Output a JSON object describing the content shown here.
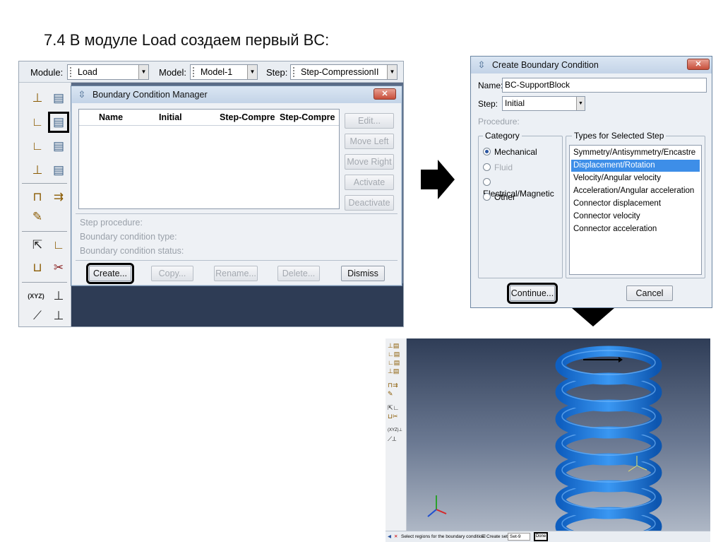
{
  "slide": {
    "title": "7.4 В модуле Load создаем первый BC:"
  },
  "context_bar": {
    "module_label": "Module:",
    "module_value": "Load",
    "model_label": "Model:",
    "model_value": "Model-1",
    "step_label": "Step:",
    "step_value": "Step-CompressionII"
  },
  "bc_manager": {
    "title": "Boundary Condition Manager",
    "close_label": "✕",
    "columns": [
      "Name",
      "Initial",
      "Step-Compre",
      "Step-Compre"
    ],
    "side_buttons": [
      "Edit...",
      "Move Left",
      "Move Right",
      "Activate",
      "Deactivate"
    ],
    "info": {
      "step_procedure": "Step procedure:",
      "bc_type": "Boundary condition type:",
      "bc_status": "Boundary condition status:"
    },
    "bottom_buttons": {
      "create": "Create...",
      "copy": "Copy...",
      "rename": "Rename...",
      "delete": "Delete...",
      "dismiss": "Dismiss"
    }
  },
  "create_bc": {
    "title": "Create Boundary Condition",
    "close_label": "✕",
    "name_label": "Name:",
    "name_value": "BC-SupportBlock",
    "step_label": "Step:",
    "step_value": "Initial",
    "procedure_label": "Procedure:",
    "category_title": "Category",
    "categories": [
      {
        "label": "Mechanical",
        "selected": true,
        "enabled": true
      },
      {
        "label": "Fluid",
        "selected": false,
        "enabled": false
      },
      {
        "label": "Electrical/Magnetic",
        "selected": false,
        "enabled": true
      },
      {
        "label": "Other",
        "selected": false,
        "enabled": true
      }
    ],
    "types_title": "Types for Selected Step",
    "types": [
      "Symmetry/Antisymmetry/Encastre",
      "Displacement/Rotation",
      "Velocity/Angular velocity",
      "Acceleration/Angular acceleration",
      "Connector displacement",
      "Connector velocity",
      "Connector acceleration"
    ],
    "selected_type": "Displacement/Rotation",
    "continue_label": "Continue...",
    "cancel_label": "Cancel"
  },
  "viewport": {
    "prompt_text": "Select regions for the boundary condition",
    "create_sets_label": "Create set:",
    "set_value": "Set-9",
    "done_label": "Done",
    "spring_color": "#1e7be0"
  },
  "colors": {
    "highlight": "#000000",
    "selection": "#3d8ee8",
    "title_bar": "#c3d3e7"
  }
}
